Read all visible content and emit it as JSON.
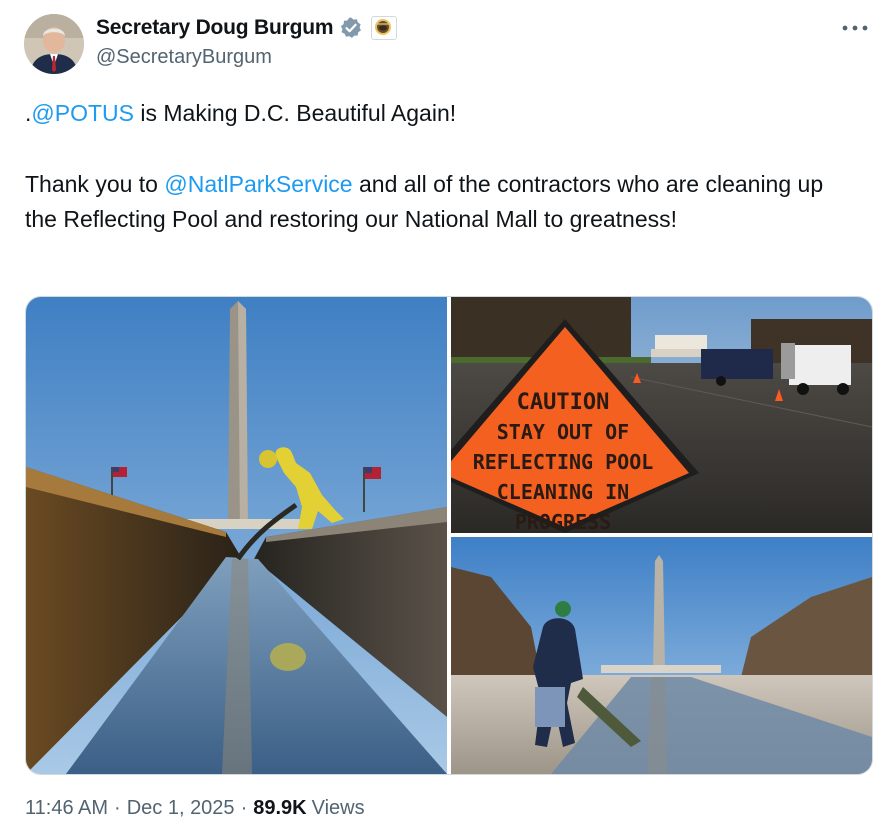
{
  "author": {
    "display_name": "Secretary Doug Burgum",
    "handle": "@SecretaryBurgum",
    "verified_icon": "gray-verified-badge-icon",
    "affiliation_icon": "interior-department-seal-icon"
  },
  "more_icon": "more-options-icon",
  "tweet": {
    "line1_prefix": ".",
    "line1_mention": "@POTUS",
    "line1_rest": " is Making D.C. Beautiful Again!",
    "line2_prefix": "Thank you to ",
    "line2_mention": "@NatlParkService",
    "line2_rest": " and all of the contractors who are cleaning up the Reflecting Pool and restoring our National Mall to greatness!"
  },
  "media": {
    "photo1": "Worker in yellow suit cleaning the Reflecting Pool with Washington Monument behind",
    "photo2": "Caution sign at Reflecting Pool with Lincoln Memorial and trucks",
    "photo3": "Worker in green hat pushing debris in drained Reflecting Pool",
    "sign_text": [
      "CAUTION",
      "STAY OUT OF",
      "REFLECTING POOL",
      "CLEANING IN",
      "PROGRESS"
    ]
  },
  "footer": {
    "time": "11:46 AM",
    "date": "Dec 1, 2025",
    "separator": "·",
    "views_count": "89.9K",
    "views_label": "Views"
  },
  "colors": {
    "link": "#1d9bf0",
    "secondary_text": "#536471",
    "primary_text": "#0f1419",
    "border": "#cfd9de"
  }
}
